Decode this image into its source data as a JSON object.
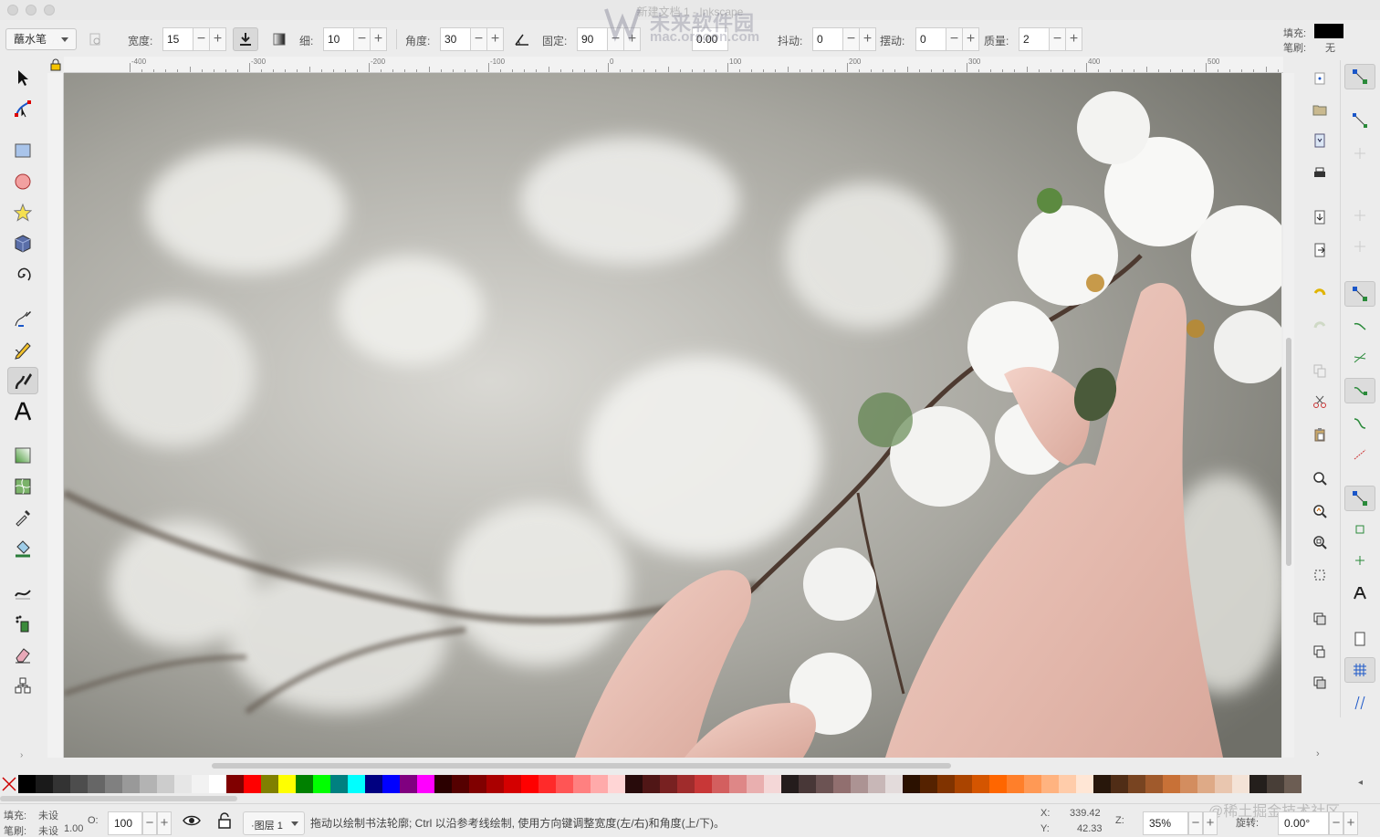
{
  "window": {
    "title": "新建文档 1 - Inkscape",
    "watermark_title": "未来软件园",
    "watermark_url": "mac.orsoon.com"
  },
  "toolbar": {
    "tool_dropdown": "蘸水笔",
    "width_label": "宽度:",
    "width_value": "15",
    "thinning_label": "细:",
    "thinning_value": "10",
    "angle_label": "角度:",
    "angle_value": "30",
    "fixation_label": "固定:",
    "fixation_value": "90",
    "caps_value": "0.00",
    "tremor_label": "抖动:",
    "tremor_value": "0",
    "wiggle_label": "摆动:",
    "wiggle_value": "0",
    "mass_label": "质量:",
    "mass_value": "2",
    "minus": "−",
    "plus": "+"
  },
  "fill_stroke": {
    "fill_label": "填充:",
    "stroke_label": "笔刷:",
    "stroke_value": "无",
    "fill_color": "#000000"
  },
  "ruler": {
    "top_ticks": [
      "-400",
      "-300",
      "-200",
      "-100",
      "0",
      "100",
      "200",
      "300",
      "400",
      "500"
    ]
  },
  "tools": [
    {
      "name": "selector-tool",
      "icon": "arrow-icon"
    },
    {
      "name": "node-tool",
      "icon": "node-icon"
    },
    {
      "name": "rect-tool",
      "icon": "rect-icon"
    },
    {
      "name": "ellipse-tool",
      "icon": "circle-icon"
    },
    {
      "name": "star-tool",
      "icon": "star-icon"
    },
    {
      "name": "3dbox-tool",
      "icon": "box3d-icon"
    },
    {
      "name": "spiral-tool",
      "icon": "spiral-icon"
    },
    {
      "name": "pen-tool",
      "icon": "pen-icon"
    },
    {
      "name": "pencil-tool",
      "icon": "pencil-icon"
    },
    {
      "name": "calligraphy-tool",
      "icon": "calligraphy-icon"
    },
    {
      "name": "text-tool",
      "icon": "text-icon"
    },
    {
      "name": "gradient-tool",
      "icon": "gradient-icon"
    },
    {
      "name": "mesh-tool",
      "icon": "mesh-icon"
    },
    {
      "name": "dropper-tool",
      "icon": "dropper-icon"
    },
    {
      "name": "paint-bucket-tool",
      "icon": "bucket-icon"
    },
    {
      "name": "tweak-tool",
      "icon": "tweak-icon"
    },
    {
      "name": "spray-tool",
      "icon": "spray-icon"
    },
    {
      "name": "eraser-tool",
      "icon": "eraser-icon"
    },
    {
      "name": "connector-tool",
      "icon": "connector-icon"
    }
  ],
  "canvas": {
    "image_alt": "photo of a hand touching white blossoms"
  },
  "palette": {
    "colors": [
      "#000000",
      "#1a1a1a",
      "#333333",
      "#4d4d4d",
      "#666666",
      "#808080",
      "#999999",
      "#b3b3b3",
      "#cccccc",
      "#e6e6e6",
      "#f2f2f2",
      "#ffffff",
      "#800000",
      "#ff0000",
      "#808000",
      "#ffff00",
      "#008000",
      "#00ff00",
      "#008080",
      "#00ffff",
      "#000080",
      "#0000ff",
      "#800080",
      "#ff00ff",
      "#2b0000",
      "#550000",
      "#800000",
      "#aa0000",
      "#d40000",
      "#ff0000",
      "#ff2a2a",
      "#ff5555",
      "#ff8080",
      "#ffaaaa",
      "#ffd5d5",
      "#280b0b",
      "#501616",
      "#782121",
      "#a02c2c",
      "#c83737",
      "#d35f5f",
      "#de8787",
      "#e9afaf",
      "#f4d7d7",
      "#241c1c",
      "#483737",
      "#6c5353",
      "#916f6f",
      "#ac9393",
      "#c8b7b7",
      "#e3dbdb",
      "#2b1100",
      "#552200",
      "#803300",
      "#aa4400",
      "#d45500",
      "#ff6600",
      "#ff7f2a",
      "#ff9955",
      "#ffb380",
      "#ffccaa",
      "#ffe6d5",
      "#28170b",
      "#502d16",
      "#784421",
      "#a05a2c",
      "#c87137",
      "#d38d5f",
      "#deaa87",
      "#e9c6af",
      "#f4e3d7",
      "#241f1c",
      "#483e37",
      "#6c5d53"
    ]
  },
  "status": {
    "fill_label": "填充:",
    "fill_value": "未设",
    "stroke_label": "笔刷:",
    "stroke_value": "未设",
    "stroke_width": "1.00",
    "opacity_label": "O:",
    "opacity_value": "100",
    "layer": "·图层 1",
    "message": "拖动以绘制书法轮廓; Ctrl 以沿参考线绘制, 使用方向键调整宽度(左/右)和角度(上/下)。",
    "x_label": "X:",
    "x_value": "339.42",
    "y_label": "Y:",
    "y_value": "42.33",
    "zoom_label": "Z:",
    "zoom_value": "35%",
    "rotate_label": "旋转:",
    "rotate_value": "0.00°",
    "credit": "@稀土掘金技术社区"
  }
}
